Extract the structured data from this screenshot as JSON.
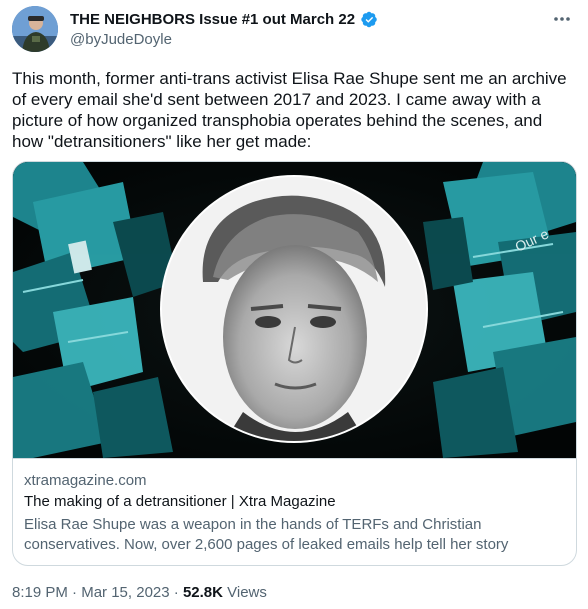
{
  "author": {
    "display_name": "THE NEIGHBORS Issue #1 out March 22",
    "handle": "@byJudeDoyle",
    "verified": true,
    "badge_color": "#1d9bf0"
  },
  "tweet": {
    "text": "This month, former anti-trans activist Elisa Rae Shupe sent me an archive of every email she'd sent between 2017 and 2023. I came away with a picture of how organized transphobia operates behind the scenes, and how \"detransitioners\" like her get made:"
  },
  "link_card": {
    "domain": "xtramagazine.com",
    "title": "The making of a detransitioner | Xtra Magazine",
    "description": "Elisa Rae Shupe was a weapon in the hands of TERFs and Christian conservatives. Now, over 2,600 pages of leaked emails help tell her story",
    "accent_color": "#1e8a93"
  },
  "meta": {
    "time": "8:19 PM",
    "separator": " · ",
    "date": "Mar 15, 2023",
    "views_count": "52.8K",
    "views_label": " Views"
  },
  "icons": {
    "more": "more-horizontal-icon",
    "verified": "verified-badge-icon"
  }
}
